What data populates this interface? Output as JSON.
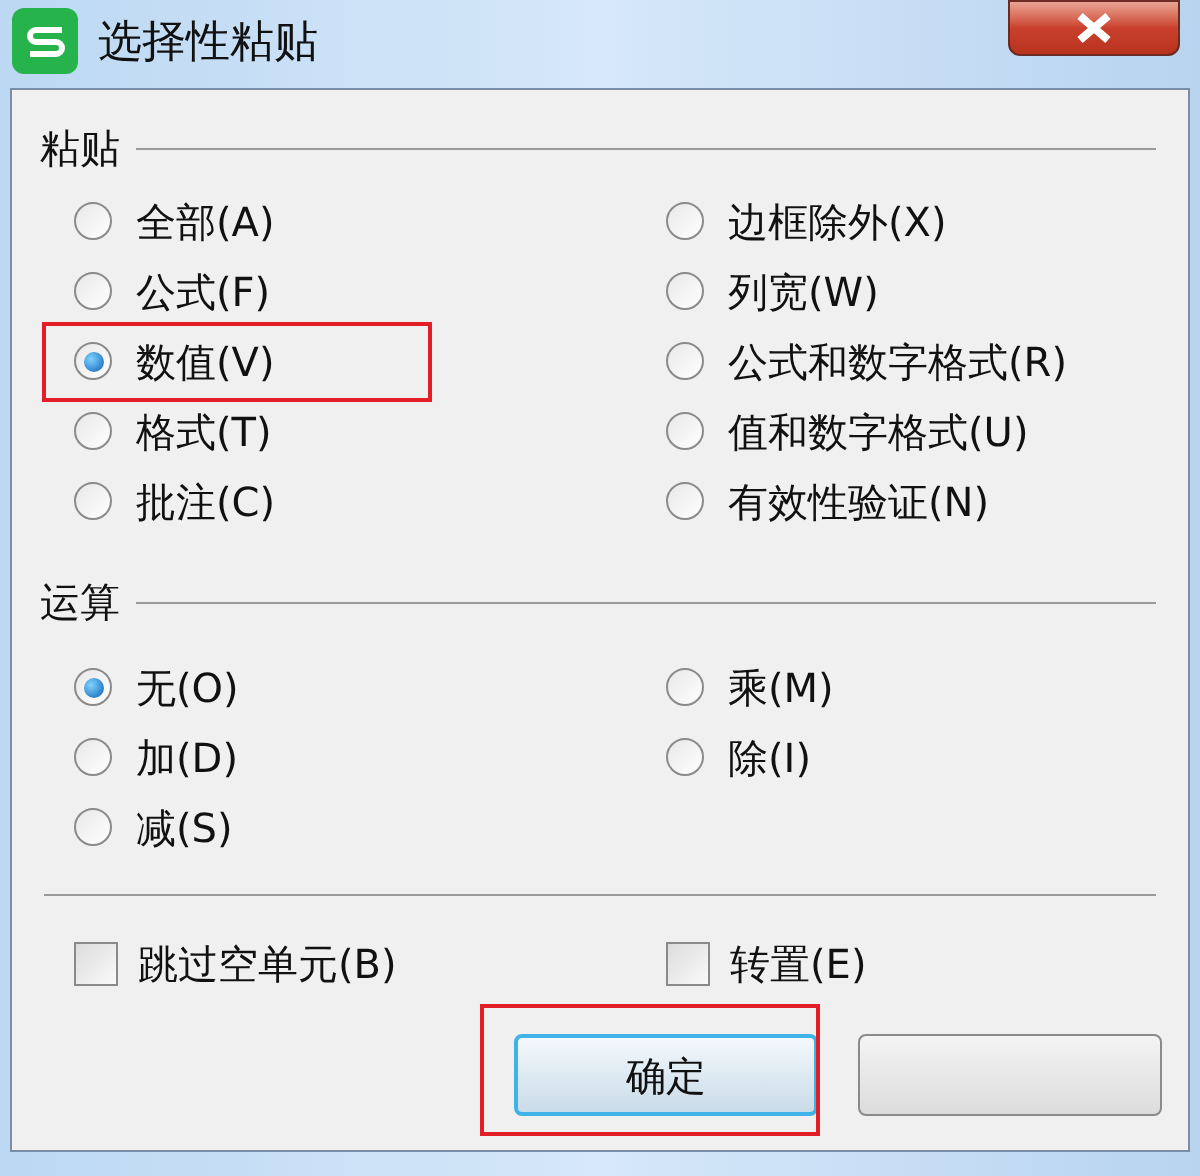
{
  "window": {
    "title": "选择性粘贴"
  },
  "paste": {
    "label": "粘贴",
    "options": [
      {
        "label": "全部(A)",
        "selected": false,
        "highlighted": false
      },
      {
        "label": "边框除外(X)",
        "selected": false,
        "highlighted": false
      },
      {
        "label": "公式(F)",
        "selected": false,
        "highlighted": false
      },
      {
        "label": "列宽(W)",
        "selected": false,
        "highlighted": false
      },
      {
        "label": "数值(V)",
        "selected": true,
        "highlighted": true
      },
      {
        "label": "公式和数字格式(R)",
        "selected": false,
        "highlighted": false
      },
      {
        "label": "格式(T)",
        "selected": false,
        "highlighted": false
      },
      {
        "label": "值和数字格式(U)",
        "selected": false,
        "highlighted": false
      },
      {
        "label": "批注(C)",
        "selected": false,
        "highlighted": false
      },
      {
        "label": "有效性验证(N)",
        "selected": false,
        "highlighted": false
      }
    ]
  },
  "operation": {
    "label": "运算",
    "options": [
      {
        "label": "无(O)",
        "selected": true
      },
      {
        "label": "乘(M)",
        "selected": false
      },
      {
        "label": "加(D)",
        "selected": false
      },
      {
        "label": "除(I)",
        "selected": false
      },
      {
        "label": "减(S)",
        "selected": false
      }
    ]
  },
  "checkboxes": [
    {
      "label": "跳过空单元(B)",
      "checked": false
    },
    {
      "label": "转置(E)",
      "checked": false
    }
  ],
  "buttons": [
    {
      "kind": "ok",
      "label": "确定",
      "highlighted": true
    },
    {
      "kind": "cancel",
      "highlighted": false
    }
  ]
}
